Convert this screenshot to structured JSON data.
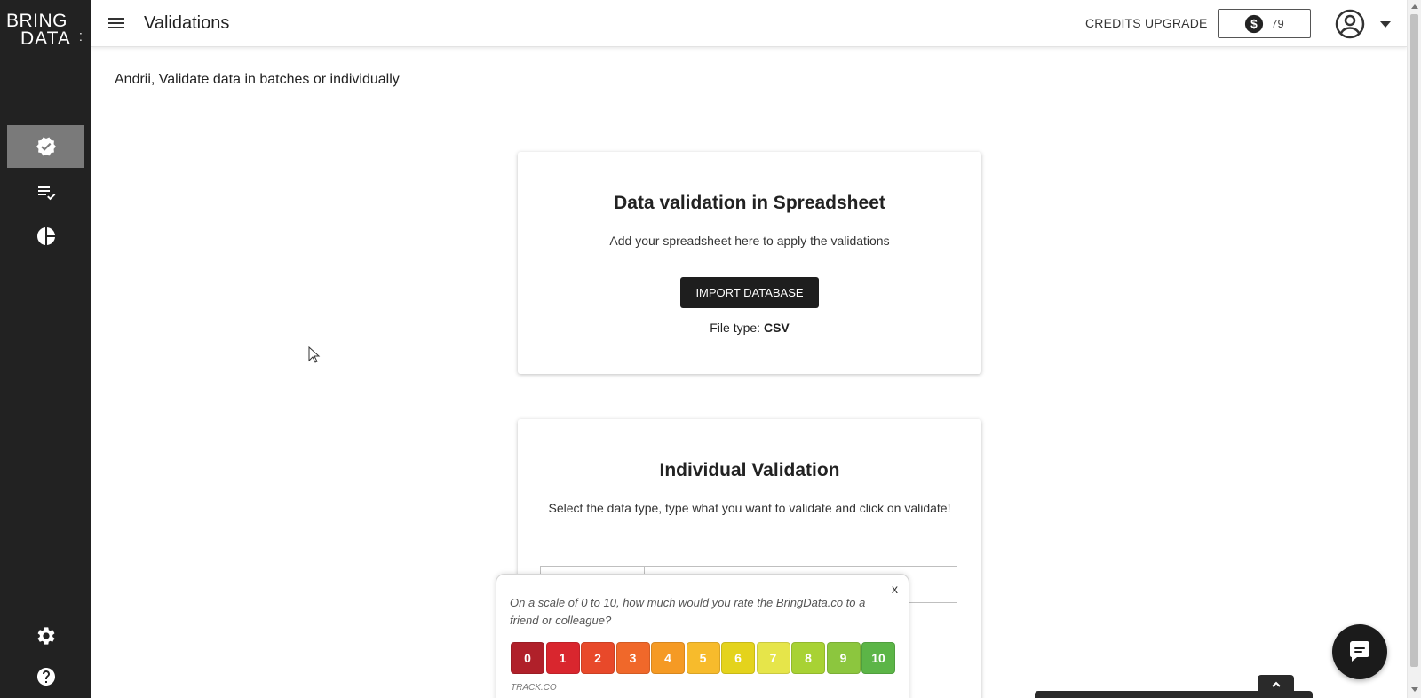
{
  "brand": {
    "logo_line1": "BRING",
    "logo_line2": "DATA"
  },
  "sidebar": {
    "items": [
      {
        "icon": "verified-badge-icon",
        "active": true
      },
      {
        "icon": "checklist-icon",
        "active": false
      },
      {
        "icon": "pie-chart-icon",
        "active": false
      },
      {
        "icon": "gear-icon",
        "active": false
      },
      {
        "icon": "help-icon",
        "active": false
      }
    ]
  },
  "header": {
    "title": "Validations",
    "credits_upgrade": "CREDITS UPGRADE",
    "credits": "79"
  },
  "main": {
    "greeting": "Andrii, Validate data in batches or individually",
    "spreadsheet_card": {
      "title": "Data validation in Spreadsheet",
      "subtitle": "Add your spreadsheet here to apply the validations",
      "button": "IMPORT DATABASE",
      "filetype_label": "File type:",
      "filetype_value": "CSV"
    },
    "individual_card": {
      "title": "Individual Validation",
      "subtitle": "Select the data type, type what you want to validate and click on validate!"
    }
  },
  "survey": {
    "close": "x",
    "question": "On a scale of 0 to 10, how much would you rate the BringData.co to a friend or colleague?",
    "scale": [
      {
        "label": "0",
        "color": "#b0202a"
      },
      {
        "label": "1",
        "color": "#d9262e"
      },
      {
        "label": "2",
        "color": "#e8492a"
      },
      {
        "label": "3",
        "color": "#f0682a"
      },
      {
        "label": "4",
        "color": "#f59a24"
      },
      {
        "label": "5",
        "color": "#f7bb2c"
      },
      {
        "label": "6",
        "color": "#e4d31c"
      },
      {
        "label": "7",
        "color": "#e6e54a"
      },
      {
        "label": "8",
        "color": "#a8d234"
      },
      {
        "label": "9",
        "color": "#8cc63e"
      },
      {
        "label": "10",
        "color": "#5cb547"
      }
    ],
    "footer": "TRACK.CO"
  }
}
